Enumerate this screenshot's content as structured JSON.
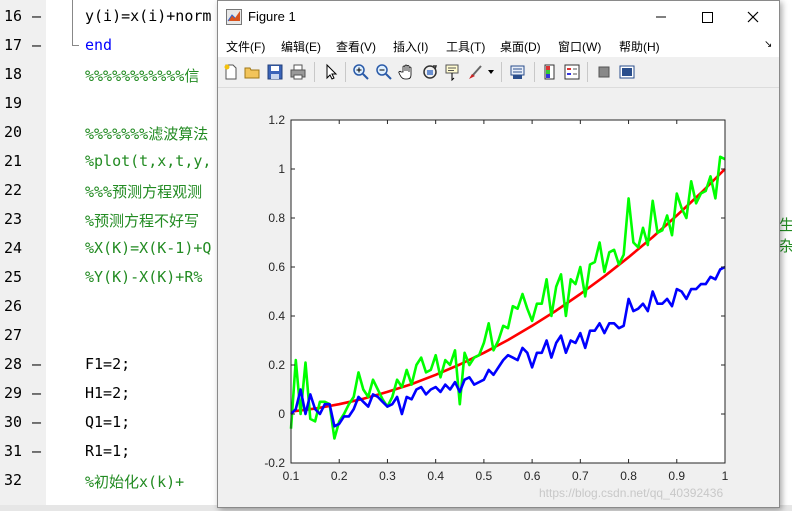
{
  "editor": {
    "lines": [
      {
        "num": "16",
        "dash": "—",
        "code": "y(i)=x(i)+norm",
        "style": "black"
      },
      {
        "num": "17",
        "dash": "—",
        "code": "end",
        "style": "blue"
      },
      {
        "num": "18",
        "dash": "",
        "code": "%%%%%%%%%%%信",
        "style": "green"
      },
      {
        "num": "19",
        "dash": "",
        "code": "",
        "style": "black"
      },
      {
        "num": "20",
        "dash": "",
        "code": "%%%%%%%滤波算法",
        "style": "green"
      },
      {
        "num": "21",
        "dash": "",
        "code": "%plot(t,x,t,y,",
        "style": "green"
      },
      {
        "num": "22",
        "dash": "",
        "code": "%%%预测方程观测",
        "style": "green"
      },
      {
        "num": "23",
        "dash": "",
        "code": "%预测方程不好写",
        "style": "green"
      },
      {
        "num": "24",
        "dash": "",
        "code": "%X(K)=X(K-1)+Q",
        "style": "green"
      },
      {
        "num": "25",
        "dash": "",
        "code": "%Y(K)-X(K)+R%",
        "style": "green"
      },
      {
        "num": "26",
        "dash": "",
        "code": "",
        "style": "black"
      },
      {
        "num": "27",
        "dash": "",
        "code": "",
        "style": "black"
      },
      {
        "num": "28",
        "dash": "—",
        "code": "F1=2;",
        "style": "black"
      },
      {
        "num": "29",
        "dash": "—",
        "code": "H1=2;",
        "style": "black"
      },
      {
        "num": "30",
        "dash": "—",
        "code": "Q1=1;",
        "style": "black"
      },
      {
        "num": "31",
        "dash": "—",
        "code": "R1=1;",
        "style": "black"
      },
      {
        "num": "32",
        "dash": "",
        "code": "%初始化x(k)+",
        "style": "green"
      }
    ],
    "edge_fragment": "生杂"
  },
  "figure": {
    "title": "Figure 1",
    "menus": [
      "文件(F)",
      "编辑(E)",
      "查看(V)",
      "插入(I)",
      "工具(T)",
      "桌面(D)",
      "窗口(W)",
      "帮助(H)"
    ],
    "toolbar_icons": [
      "new-figure-icon",
      "open-file-icon",
      "save-icon",
      "print-icon",
      "pointer-icon",
      "zoom-in-icon",
      "zoom-out-icon",
      "pan-icon",
      "rotate-3d-icon",
      "data-cursor-icon",
      "brush-icon",
      "link-plot-icon",
      "insert-colorbar-icon",
      "insert-legend-icon",
      "hide-plot-tools-icon",
      "show-plot-tools-icon"
    ]
  },
  "chart_data": {
    "type": "line",
    "title": "",
    "xlabel": "",
    "ylabel": "",
    "xlim": [
      0.1,
      1.0
    ],
    "ylim": [
      -0.2,
      1.2
    ],
    "xticks": [
      "0.1",
      "0.2",
      "0.3",
      "0.4",
      "0.5",
      "0.6",
      "0.7",
      "0.8",
      "0.9",
      "1"
    ],
    "yticks": [
      "-0.2",
      "0",
      "0.2",
      "0.4",
      "0.6",
      "0.8",
      "1",
      "1.2"
    ],
    "grid": false,
    "series": [
      {
        "color": "#ff0000",
        "x": [
          0.1,
          0.15,
          0.2,
          0.25,
          0.3,
          0.35,
          0.4,
          0.45,
          0.5,
          0.55,
          0.6,
          0.65,
          0.7,
          0.75,
          0.8,
          0.85,
          0.9,
          0.95,
          1.0
        ],
        "y": [
          0.01,
          0.022,
          0.04,
          0.062,
          0.09,
          0.122,
          0.16,
          0.202,
          0.25,
          0.302,
          0.36,
          0.422,
          0.49,
          0.562,
          0.64,
          0.722,
          0.81,
          0.902,
          1.0
        ]
      },
      {
        "color": "#00ff00",
        "x": [
          0.1,
          0.11,
          0.12,
          0.13,
          0.14,
          0.15,
          0.16,
          0.17,
          0.18,
          0.19,
          0.2,
          0.21,
          0.22,
          0.23,
          0.24,
          0.25,
          0.26,
          0.27,
          0.28,
          0.29,
          0.3,
          0.31,
          0.32,
          0.33,
          0.34,
          0.35,
          0.36,
          0.37,
          0.38,
          0.39,
          0.4,
          0.41,
          0.42,
          0.43,
          0.44,
          0.45,
          0.46,
          0.47,
          0.48,
          0.49,
          0.5,
          0.51,
          0.52,
          0.53,
          0.54,
          0.55,
          0.56,
          0.57,
          0.58,
          0.59,
          0.6,
          0.61,
          0.62,
          0.63,
          0.64,
          0.65,
          0.66,
          0.67,
          0.68,
          0.69,
          0.7,
          0.71,
          0.72,
          0.73,
          0.74,
          0.75,
          0.76,
          0.77,
          0.78,
          0.79,
          0.8,
          0.81,
          0.82,
          0.83,
          0.84,
          0.85,
          0.86,
          0.87,
          0.88,
          0.89,
          0.9,
          0.91,
          0.92,
          0.93,
          0.94,
          0.95,
          0.96,
          0.97,
          0.98,
          0.99,
          1.0
        ],
        "y": [
          -0.06,
          0.22,
          0.0,
          0.21,
          -0.02,
          -0.03,
          0.05,
          0.05,
          0.04,
          -0.1,
          -0.03,
          0.0,
          0.04,
          0.07,
          0.17,
          0.1,
          0.07,
          0.14,
          0.1,
          0.06,
          0.03,
          0.07,
          0.14,
          0.11,
          0.18,
          0.12,
          0.2,
          0.23,
          0.17,
          0.18,
          0.24,
          0.15,
          0.22,
          0.2,
          0.26,
          0.04,
          0.25,
          0.2,
          0.23,
          0.24,
          0.29,
          0.37,
          0.26,
          0.3,
          0.36,
          0.35,
          0.44,
          0.43,
          0.49,
          0.43,
          0.38,
          0.45,
          0.45,
          0.55,
          0.4,
          0.52,
          0.57,
          0.4,
          0.55,
          0.53,
          0.6,
          0.48,
          0.61,
          0.62,
          0.7,
          0.58,
          0.66,
          0.67,
          0.61,
          0.65,
          0.88,
          0.7,
          0.68,
          0.76,
          0.69,
          0.87,
          0.74,
          0.75,
          0.81,
          0.73,
          0.9,
          0.84,
          0.8,
          0.95,
          0.86,
          0.9,
          0.91,
          0.97,
          0.88,
          1.05,
          1.04
        ]
      },
      {
        "color": "#0000ff",
        "x": [
          0.1,
          0.11,
          0.12,
          0.13,
          0.14,
          0.15,
          0.16,
          0.17,
          0.18,
          0.19,
          0.2,
          0.21,
          0.22,
          0.23,
          0.24,
          0.25,
          0.26,
          0.27,
          0.28,
          0.29,
          0.3,
          0.31,
          0.32,
          0.33,
          0.34,
          0.35,
          0.36,
          0.37,
          0.38,
          0.39,
          0.4,
          0.41,
          0.42,
          0.43,
          0.44,
          0.45,
          0.46,
          0.47,
          0.48,
          0.49,
          0.5,
          0.51,
          0.52,
          0.53,
          0.54,
          0.55,
          0.56,
          0.57,
          0.58,
          0.59,
          0.6,
          0.61,
          0.62,
          0.63,
          0.64,
          0.65,
          0.66,
          0.67,
          0.68,
          0.69,
          0.7,
          0.71,
          0.72,
          0.73,
          0.74,
          0.75,
          0.76,
          0.77,
          0.78,
          0.79,
          0.8,
          0.81,
          0.82,
          0.83,
          0.84,
          0.85,
          0.86,
          0.87,
          0.88,
          0.89,
          0.9,
          0.91,
          0.92,
          0.93,
          0.94,
          0.95,
          0.96,
          0.97,
          0.98,
          0.99,
          1.0
        ],
        "y": [
          0.0,
          0.02,
          0.1,
          0.0,
          0.08,
          0.02,
          0.0,
          0.04,
          0.04,
          -0.05,
          -0.04,
          -0.01,
          -0.01,
          0.02,
          0.07,
          0.05,
          0.03,
          0.08,
          0.07,
          0.05,
          0.03,
          0.04,
          0.07,
          0.0,
          0.07,
          0.06,
          0.1,
          0.11,
          0.08,
          0.1,
          0.11,
          0.09,
          0.12,
          0.1,
          0.13,
          0.09,
          0.14,
          0.15,
          0.12,
          0.13,
          0.14,
          0.18,
          0.16,
          0.19,
          0.22,
          0.24,
          0.23,
          0.22,
          0.27,
          0.25,
          0.19,
          0.25,
          0.25,
          0.3,
          0.23,
          0.29,
          0.32,
          0.25,
          0.3,
          0.29,
          0.33,
          0.27,
          0.34,
          0.34,
          0.37,
          0.33,
          0.37,
          0.37,
          0.35,
          0.36,
          0.47,
          0.42,
          0.43,
          0.45,
          0.42,
          0.5,
          0.45,
          0.45,
          0.47,
          0.44,
          0.51,
          0.5,
          0.47,
          0.51,
          0.51,
          0.53,
          0.53,
          0.56,
          0.55,
          0.59,
          0.6
        ]
      }
    ]
  },
  "watermark": "https://blog.csdn.net/qq_40392436"
}
